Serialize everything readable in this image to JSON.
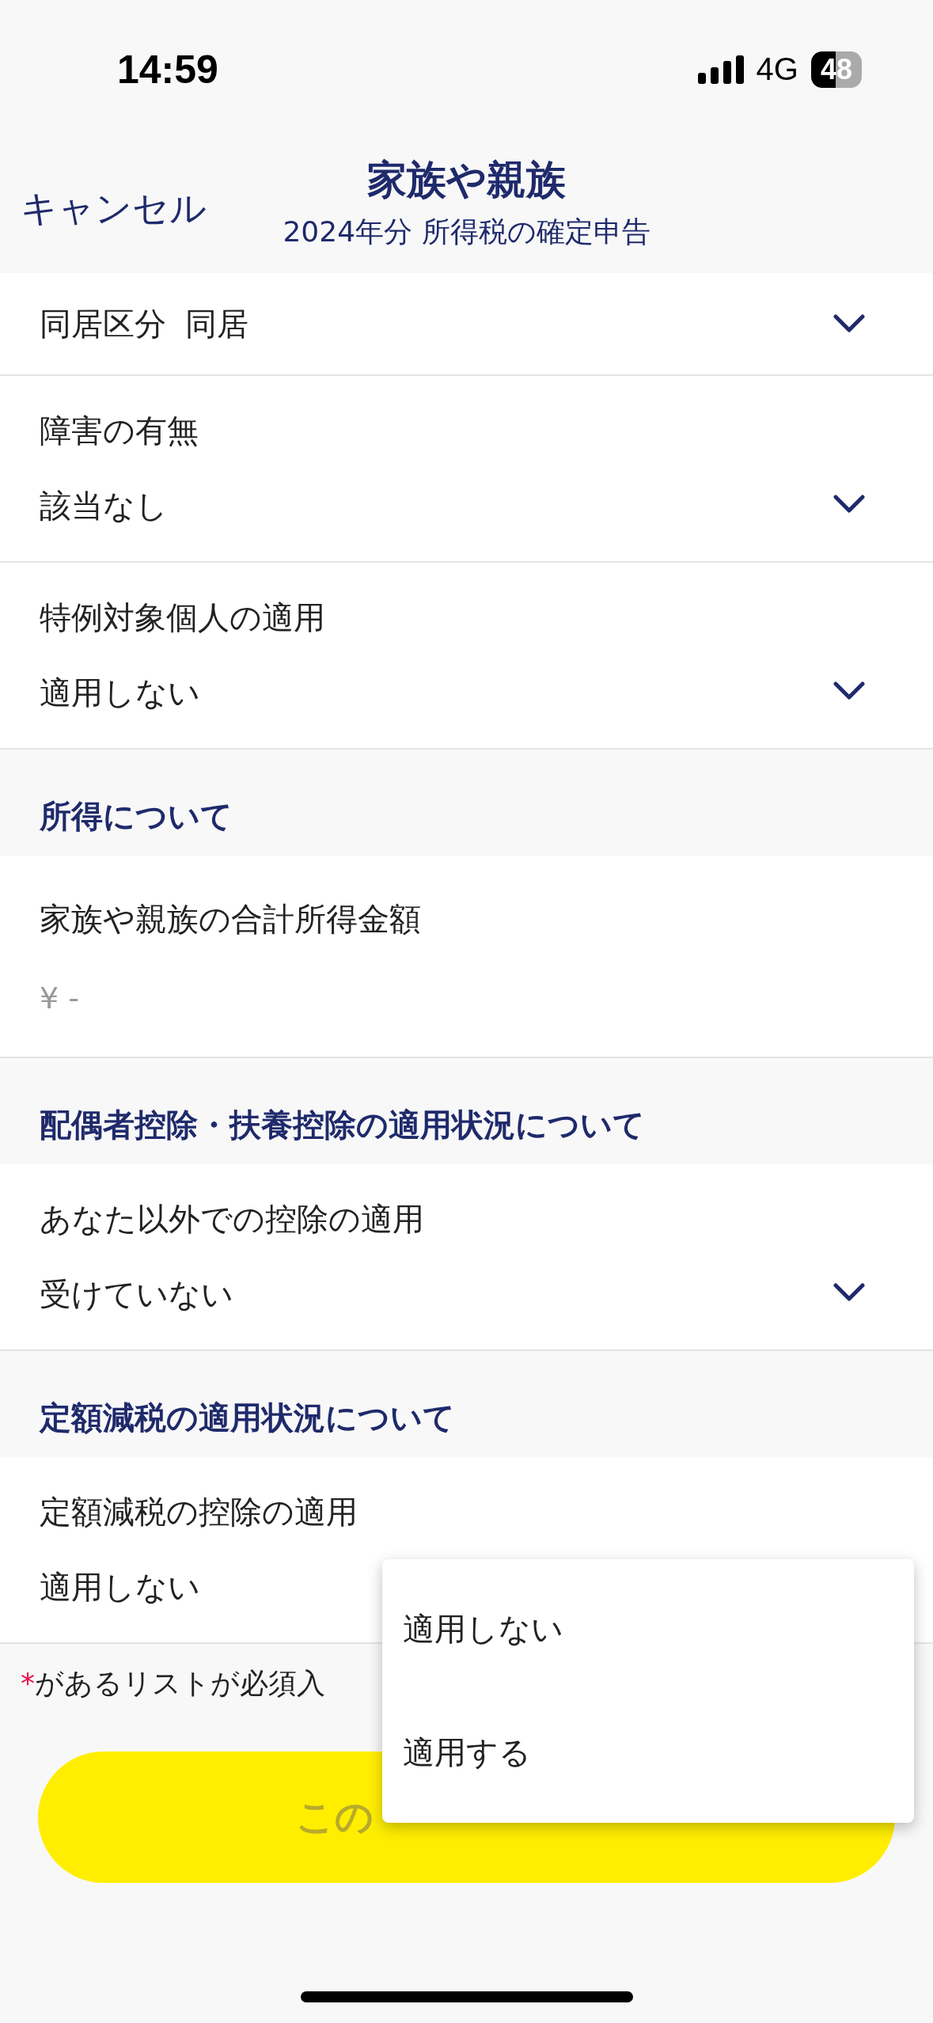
{
  "status_bar": {
    "time": "14:59",
    "network": "4G",
    "battery": "48"
  },
  "header": {
    "cancel": "キャンセル",
    "title": "家族や親族",
    "subtitle": "2024年分 所得税の確定申告"
  },
  "rows": [
    {
      "kind": "inline",
      "label": "同居区分",
      "value": "同居"
    },
    {
      "kind": "select",
      "label": "障害の有無",
      "value": "該当なし"
    },
    {
      "kind": "select",
      "label": "特例対象個人の適用",
      "value": "適用しない"
    },
    {
      "kind": "section",
      "label": "所得について"
    },
    {
      "kind": "amount",
      "label": "家族や親族の合計所得金額",
      "placeholder": "¥ -"
    },
    {
      "kind": "section",
      "label": "配偶者控除・扶養控除の適用状況について"
    },
    {
      "kind": "select",
      "label": "あなた以外での控除の適用",
      "value": "受けていない"
    },
    {
      "kind": "section",
      "label": "定額減税の適用状況について"
    },
    {
      "kind": "open",
      "label": "定額減税の控除の適用",
      "value": "適用しない"
    }
  ],
  "footnote": {
    "mark": "*",
    "text": "があるリストが必須入"
  },
  "submit": {
    "label": "この",
    "disabled": true
  },
  "dropdown": {
    "options": [
      "適用しない",
      "適用する"
    ]
  }
}
